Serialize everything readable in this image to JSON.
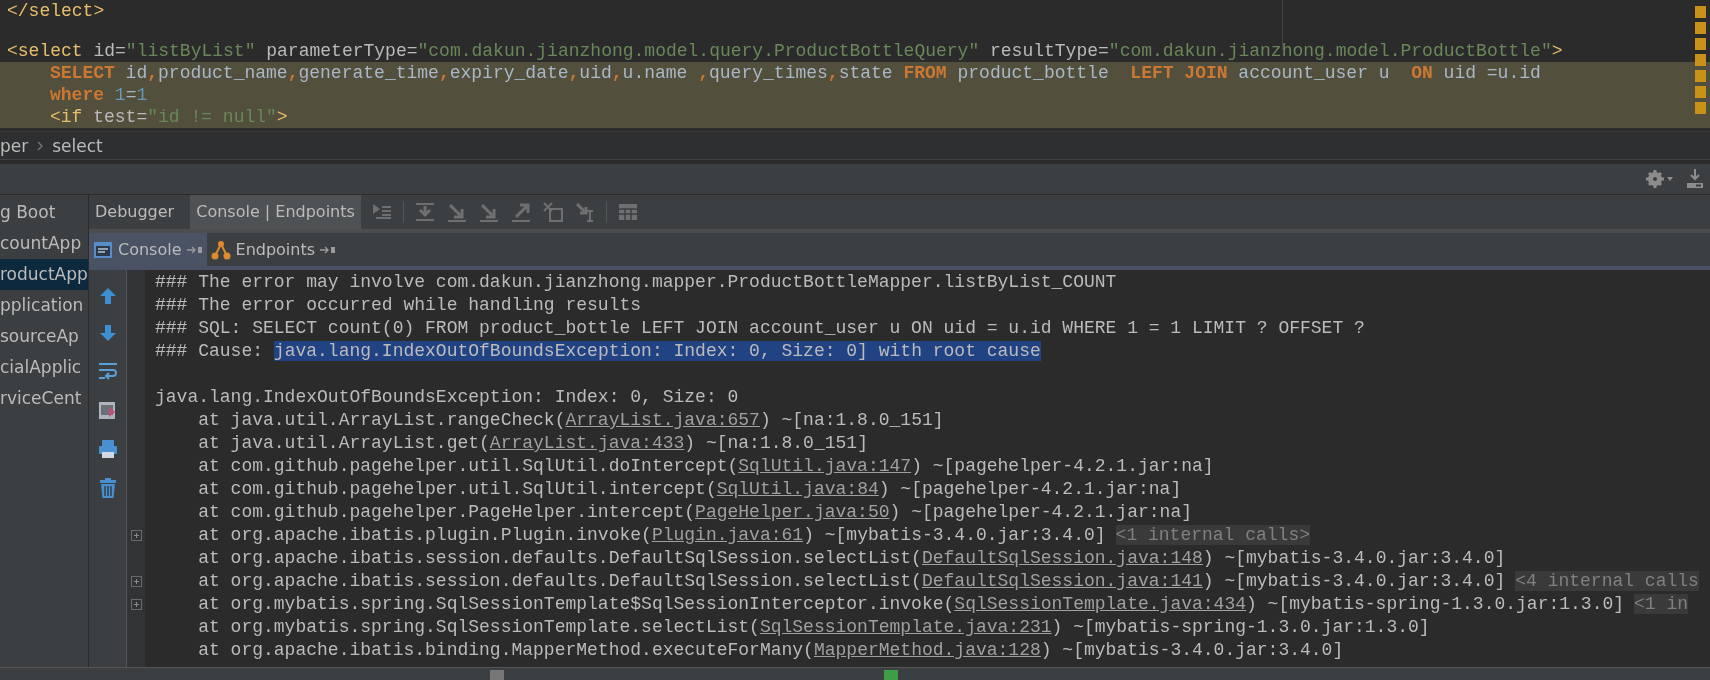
{
  "editor": {
    "lines": [
      {
        "highlighted": false,
        "blank_before": false,
        "tokens": [
          {
            "kind": "tag",
            "t": "</select>"
          }
        ]
      },
      {
        "highlighted": false,
        "blank_before": true,
        "tokens": [
          {
            "kind": "tag",
            "t": "<select"
          },
          {
            "kind": "attr",
            "t": " id="
          },
          {
            "kind": "str",
            "t": "\"listByList\""
          },
          {
            "kind": "attr",
            "t": " parameterType="
          },
          {
            "kind": "str",
            "t": "\"com.dakun.jianzhong.model.query.ProductBottleQuery\""
          },
          {
            "kind": "attr",
            "t": " resultType="
          },
          {
            "kind": "str",
            "t": "\"com.dakun.jianzhong.model.ProductBottle\""
          },
          {
            "kind": "tag",
            "t": ">"
          }
        ]
      },
      {
        "highlighted": true,
        "blank_before": false,
        "tokens": [
          {
            "kind": "kw",
            "t": "SELECT"
          },
          {
            "kind": "plain",
            "t": " id"
          },
          {
            "kind": "kw",
            "t": ","
          },
          {
            "kind": "plain",
            "t": "product_name"
          },
          {
            "kind": "kw",
            "t": ","
          },
          {
            "kind": "plain",
            "t": "generate_time"
          },
          {
            "kind": "kw",
            "t": ","
          },
          {
            "kind": "plain",
            "t": "expiry_date"
          },
          {
            "kind": "kw",
            "t": ","
          },
          {
            "kind": "plain",
            "t": "uid"
          },
          {
            "kind": "kw",
            "t": ","
          },
          {
            "kind": "plain",
            "t": "u.name "
          },
          {
            "kind": "kw",
            "t": ","
          },
          {
            "kind": "plain",
            "t": "query_times"
          },
          {
            "kind": "kw",
            "t": ","
          },
          {
            "kind": "plain",
            "t": "state "
          },
          {
            "kind": "kw",
            "t": "FROM"
          },
          {
            "kind": "plain",
            "t": " product_bottle  "
          },
          {
            "kind": "kw",
            "t": "LEFT JOIN"
          },
          {
            "kind": "plain",
            "t": " account_user u  "
          },
          {
            "kind": "kw",
            "t": "ON"
          },
          {
            "kind": "plain",
            "t": " uid =u.id"
          }
        ]
      },
      {
        "highlighted": true,
        "blank_before": false,
        "tokens": [
          {
            "kind": "kw",
            "t": "where"
          },
          {
            "kind": "num",
            "t": " 1"
          },
          {
            "kind": "plain",
            "t": "="
          },
          {
            "kind": "num",
            "t": "1"
          }
        ]
      },
      {
        "highlighted": true,
        "blank_before": false,
        "tokens": [
          {
            "kind": "tag",
            "t": "<if"
          },
          {
            "kind": "attr",
            "t": " test="
          },
          {
            "kind": "str",
            "t": "\"id != null\""
          },
          {
            "kind": "tag",
            "t": ">"
          }
        ]
      }
    ]
  },
  "breadcrumb": [
    {
      "label": "per"
    },
    {
      "label": "select"
    }
  ],
  "run_list": {
    "items": [
      {
        "label": "g Boot",
        "selected": false
      },
      {
        "label": "countApp",
        "selected": false
      },
      {
        "label": "roductApp",
        "selected": true
      },
      {
        "label": "pplication",
        "selected": false
      },
      {
        "label": "sourceAp",
        "selected": false
      },
      {
        "label": "cialApplic",
        "selected": false
      },
      {
        "label": "rviceCent",
        "selected": false
      }
    ]
  },
  "tool_window": {
    "tabs": [
      {
        "label": "Debugger",
        "selected": false
      },
      {
        "label": "Console | Endpoints",
        "selected": true
      }
    ],
    "subtabs": [
      {
        "label": "Console",
        "kind": "console",
        "selected": true
      },
      {
        "label": "Endpoints",
        "kind": "endpoints",
        "selected": false
      }
    ]
  },
  "console": {
    "lines": [
      {
        "kind": "text",
        "folded": false,
        "segments": [
          {
            "kind": "text",
            "t": "### The error may involve com.dakun.jianzhong.mapper.ProductBottleMapper.listByList_COUNT"
          }
        ]
      },
      {
        "kind": "text",
        "folded": false,
        "segments": [
          {
            "kind": "text",
            "t": "### The error occurred while handling results"
          }
        ]
      },
      {
        "kind": "text",
        "folded": false,
        "segments": [
          {
            "kind": "text",
            "t": "### SQL: SELECT count(0) FROM product_bottle LEFT JOIN account_user u ON uid = u.id WHERE 1 = 1 LIMIT ? OFFSET ?"
          }
        ]
      },
      {
        "kind": "text",
        "folded": false,
        "segments": [
          {
            "kind": "text",
            "t": "### Cause: "
          },
          {
            "kind": "selected",
            "t": "java.lang.IndexOutOfBoundsException: Index: 0, Size: 0] with root cause"
          }
        ]
      },
      {
        "kind": "blank",
        "folded": false
      },
      {
        "kind": "text",
        "folded": false,
        "segments": [
          {
            "kind": "text",
            "t": "java.lang.IndexOutOfBoundsException: Index: 0, Size: 0"
          }
        ]
      },
      {
        "kind": "text",
        "folded": false,
        "segments": [
          {
            "kind": "text",
            "t": "    at java.util.ArrayList.rangeCheck("
          },
          {
            "kind": "link",
            "t": "ArrayList.java:657"
          },
          {
            "kind": "text",
            "t": ") ~[na:1.8.0_151]"
          }
        ]
      },
      {
        "kind": "text",
        "folded": false,
        "segments": [
          {
            "kind": "text",
            "t": "    at java.util.ArrayList.get("
          },
          {
            "kind": "link",
            "t": "ArrayList.java:433"
          },
          {
            "kind": "text",
            "t": ") ~[na:1.8.0_151]"
          }
        ]
      },
      {
        "kind": "text",
        "folded": false,
        "segments": [
          {
            "kind": "text",
            "t": "    at com.github.pagehelper.util.SqlUtil.doIntercept("
          },
          {
            "kind": "link",
            "t": "SqlUtil.java:147"
          },
          {
            "kind": "text",
            "t": ") ~[pagehelper-4.2.1.jar:na]"
          }
        ]
      },
      {
        "kind": "text",
        "folded": false,
        "segments": [
          {
            "kind": "text",
            "t": "    at com.github.pagehelper.util.SqlUtil.intercept("
          },
          {
            "kind": "link",
            "t": "SqlUtil.java:84"
          },
          {
            "kind": "text",
            "t": ") ~[pagehelper-4.2.1.jar:na]"
          }
        ]
      },
      {
        "kind": "text",
        "folded": false,
        "segments": [
          {
            "kind": "text",
            "t": "    at com.github.pagehelper.PageHelper.intercept("
          },
          {
            "kind": "link",
            "t": "PageHelper.java:50"
          },
          {
            "kind": "text",
            "t": ") ~[pagehelper-4.2.1.jar:na]"
          }
        ]
      },
      {
        "kind": "text",
        "folded": true,
        "segments": [
          {
            "kind": "text",
            "t": "    at org.apache.ibatis.plugin.Plugin.invoke("
          },
          {
            "kind": "link",
            "t": "Plugin.java:61"
          },
          {
            "kind": "text",
            "t": ") ~[mybatis-3.4.0.jar:3.4.0]"
          },
          {
            "kind": "hint",
            "t": "<1 internal calls>"
          }
        ]
      },
      {
        "kind": "text",
        "folded": false,
        "segments": [
          {
            "kind": "text",
            "t": "    at org.apache.ibatis.session.defaults.DefaultSqlSession.selectList("
          },
          {
            "kind": "link",
            "t": "DefaultSqlSession.java:148"
          },
          {
            "kind": "text",
            "t": ") ~[mybatis-3.4.0.jar:3.4.0]"
          }
        ]
      },
      {
        "kind": "text",
        "folded": true,
        "segments": [
          {
            "kind": "text",
            "t": "    at org.apache.ibatis.session.defaults.DefaultSqlSession.selectList("
          },
          {
            "kind": "link",
            "t": "DefaultSqlSession.java:141"
          },
          {
            "kind": "text",
            "t": ") ~[mybatis-3.4.0.jar:3.4.0]"
          },
          {
            "kind": "hint",
            "t": "<4 internal calls"
          }
        ]
      },
      {
        "kind": "text",
        "folded": true,
        "segments": [
          {
            "kind": "text",
            "t": "    at org.mybatis.spring.SqlSessionTemplate$SqlSessionInterceptor.invoke("
          },
          {
            "kind": "link",
            "t": "SqlSessionTemplate.java:434"
          },
          {
            "kind": "text",
            "t": ") ~[mybatis-spring-1.3.0.jar:1.3.0]"
          },
          {
            "kind": "hint",
            "t": "<1 in"
          }
        ]
      },
      {
        "kind": "text",
        "folded": false,
        "segments": [
          {
            "kind": "text",
            "t": "    at org.mybatis.spring.SqlSessionTemplate.selectList("
          },
          {
            "kind": "link",
            "t": "SqlSessionTemplate.java:231"
          },
          {
            "kind": "text",
            "t": ") ~[mybatis-spring-1.3.0.jar:1.3.0]"
          }
        ]
      },
      {
        "kind": "text",
        "folded": false,
        "segments": [
          {
            "kind": "text",
            "t": "    at org.apache.ibatis.binding.MapperMethod.executeForMany("
          },
          {
            "kind": "link",
            "t": "MapperMethod.java:128"
          },
          {
            "kind": "text",
            "t": ") ~[mybatis-3.4.0.jar:3.4.0]"
          }
        ]
      }
    ]
  }
}
